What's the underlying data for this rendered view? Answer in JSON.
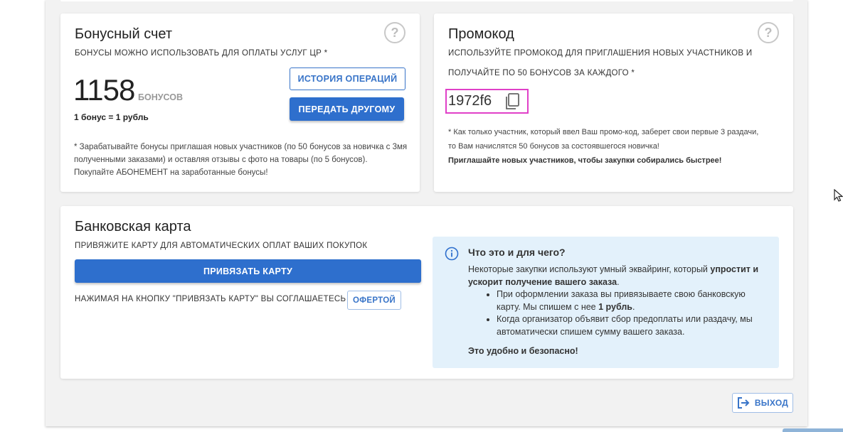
{
  "bonus": {
    "title": "Бонусный счет",
    "subtitle": "бонусы можно использовать для оплаты услуг ЦР *",
    "amount": "1158",
    "unit": "бонусов",
    "rate": "1 бонус = 1 рубль",
    "history_button": "История операций",
    "transfer_button": "Передать другому",
    "note_1": "* Зарабатывайте бонусы приглашая новых участников (по 50 бонусов за новичка с 3мя",
    "note_2": "полученными заказами) и оставляя отзывы с фото на товары (по 5 бонусов).",
    "note_3": "Покупайте АБОНЕМЕНТ на заработанные бонусы!"
  },
  "promo": {
    "title": "Промокод",
    "subtitle_1": "используйте промокод для приглашения новых участников и",
    "subtitle_2": "получайте по 50 бонусов за каждого *",
    "code": "1972f6",
    "note_1": "* Как только участник, который ввел Ваш промо-код, заберет свои первые 3 раздачи,",
    "note_2": "то Вам начислятся 50 бонусов за состоявшегося новичка!",
    "note_bold": "Приглашайте новых участников, чтобы закупки собирались быстрее!"
  },
  "bank": {
    "title": "Банковская карта",
    "subtitle": "привяжите карту для автоматических оплат ваших покупок",
    "bind_button": "Привязать карту",
    "agree_text": "нажимая на кнопку \"привязать карту\" вы соглашаетесь с",
    "offer_button": "офертой"
  },
  "info": {
    "title": "Что это и для чего?",
    "intro_1": "Некоторые закупки используют умный эквайринг, который ",
    "intro_bold_1": "упростит и",
    "intro_bold_2": "ускорит получение вашего заказа",
    "intro_end": ".",
    "bullet_1a": "При оформлении заказа вы привязываете свою банковскую",
    "bullet_1b": "карту. Мы спишем с нее ",
    "bullet_1_bold": "1 рубль",
    "bullet_1_end": ".",
    "bullet_2a": "Когда организатор объявит сбор предоплаты или раздачу, мы",
    "bullet_2b": "автоматически спишем сумму вашего заказа.",
    "footer": "Это удобно и безопасно!"
  },
  "logout_button": "Выход",
  "icons": {
    "help": "question-circle-icon",
    "copy": "copy-icon",
    "info": "info-circle-icon",
    "logout": "logout-icon",
    "cursor": "mouse-cursor-icon"
  },
  "colors": {
    "primary": "#2e6fcd",
    "info_bg": "#e3f1fb",
    "promo_border": "#e040c8"
  }
}
